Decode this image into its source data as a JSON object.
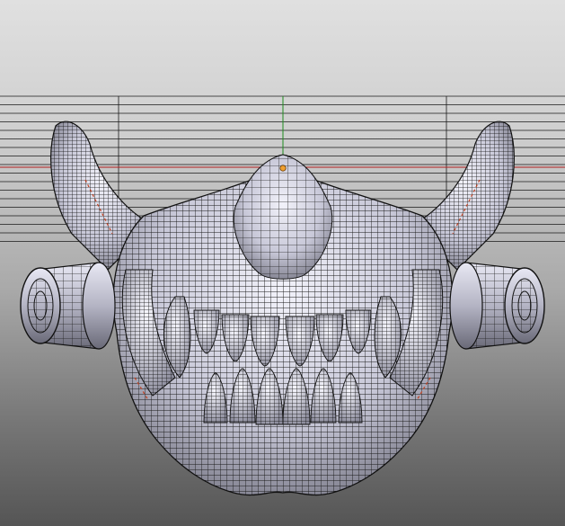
{
  "viewport": {
    "background_top": "#e0e0e0",
    "background_bottom": "#555555",
    "grid_line_color": "#1a1a1a",
    "x_axis_color": "#b01e1e",
    "y_axis_color": "#1e8c1e",
    "origin_marker_color": "#f0a030",
    "mesh_fill_color": "#d0d0e0",
    "mesh_wire_color": "#1a1a1a",
    "mesh_seam_color": "#c04020"
  },
  "scene": {
    "object": "mask-mesh",
    "display_mode": "wireframe-on-shaded",
    "parts": [
      "mask-body",
      "nose-bridge",
      "left-horn",
      "right-horn",
      "left-filter",
      "right-filter",
      "upper-teeth",
      "lower-teeth",
      "chin"
    ]
  }
}
